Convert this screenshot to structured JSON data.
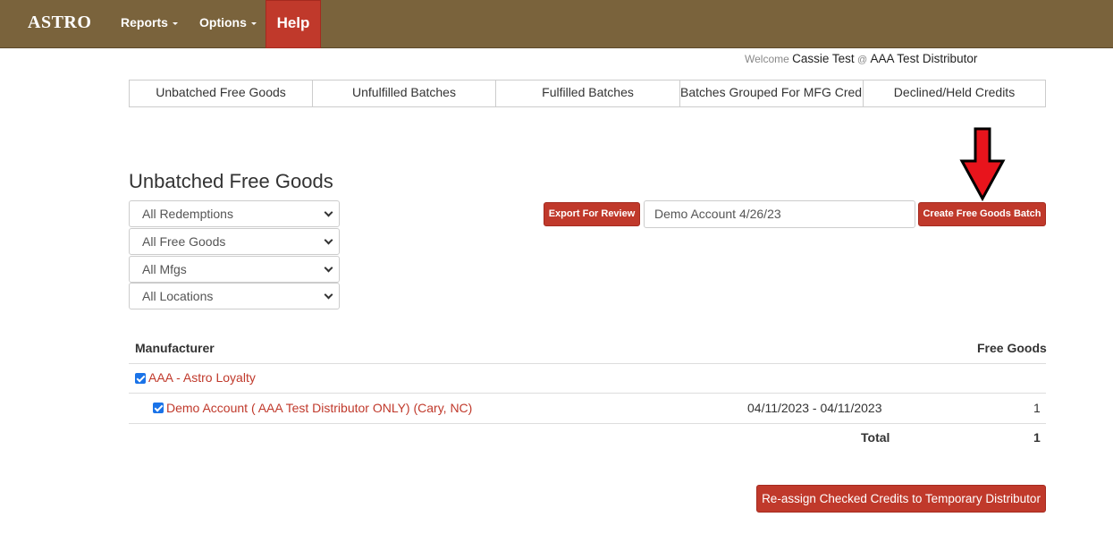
{
  "navbar": {
    "brand": "ASTRO",
    "reports": "Reports",
    "options": "Options",
    "help": "Help"
  },
  "welcome": {
    "prefix": "Welcome",
    "user": "Cassie Test",
    "at": "@",
    "distributor": "AAA Test Distributor"
  },
  "tabs": [
    {
      "label": "Unbatched Free Goods"
    },
    {
      "label": "Unfulfilled Batches"
    },
    {
      "label": "Fulfilled Batches"
    },
    {
      "label": "Batches Grouped For MFG Credit"
    },
    {
      "label": "Declined/Held Credits"
    }
  ],
  "page_title": "Unbatched Free Goods",
  "filters": {
    "redemptions": "All Redemptions",
    "free_goods": "All Free Goods",
    "mfgs": "All Mfgs",
    "locations": "All Locations"
  },
  "actions": {
    "export": "Export For Review",
    "batch_name": "Demo Account 4/26/23",
    "create": "Create Free Goods Batch",
    "reassign": "Re-assign Checked Credits to Temporary Distributor"
  },
  "table": {
    "col_manufacturer": "Manufacturer",
    "col_free_goods": "Free Goods",
    "group_label": "AAA - Astro Loyalty",
    "row": {
      "account": "Demo Account ( AAA Test Distributor ONLY) (Cary, NC)",
      "dates": "04/11/2023 - 04/11/2023",
      "free_goods": "1"
    },
    "total_label": "Total",
    "total_value": "1"
  },
  "colors": {
    "navbar": "#7a633c",
    "accent": "#c0392b",
    "checkbox": "#1a73e8",
    "arrow": "#e8141c"
  }
}
